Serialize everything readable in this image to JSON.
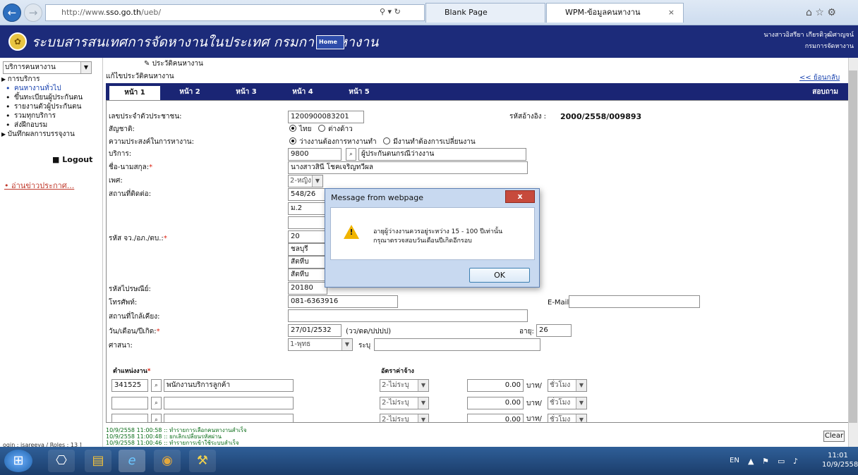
{
  "browser": {
    "url_prefix": "http://www.",
    "url_host": "sso.go.th",
    "url_path": "/ueb/",
    "tabs": [
      "Blank Page",
      "WPM-ข้อมูลคนหางาน"
    ]
  },
  "header": {
    "title": "ระบบสารสนเทศการจัดหางานในประเทศ กรมการจัดหางาน",
    "home_label": "Home",
    "user_name": "นางสาวอิสรียา เกียรติวุฒิศาญจน์",
    "department": "กรมการจัดหางาน"
  },
  "sidebar": {
    "service_select": "บริการคนหางาน",
    "menu_head_1": "การบริการ",
    "items": [
      "คนหางานทั่วไป",
      "ขึ้นทะเบียนผู้ประกันตน",
      "รายงานตัวผู้ประกันตน",
      "รวมทุกบริการ",
      "ส่งฝึกอบรม"
    ],
    "menu_head_2": "บันทึกผลการบรรจุงาน",
    "logout": "Logout",
    "news": "อ่านข่าวประกาศ..."
  },
  "content": {
    "crumb": "ประวัติคนหางาน",
    "page_title": "แก้ไขประวัติคนหางาน",
    "back": "<< ย้อนกลับ",
    "tabs": [
      "หน้า 1",
      "หน้า 2",
      "หน้า 3",
      "หน้า 4",
      "หน้า 5"
    ],
    "tab_right": "สอบถาม"
  },
  "form": {
    "id_label": "เลขประจำตัวประชาชน:",
    "id_value": "1200900083201",
    "ref_label": "รหัสอ้างอิง :",
    "ref_value": "2000/2558/009893",
    "nationality_label": "สัญชาติ:",
    "nationality_opt1": "ไทย",
    "nationality_opt2": "ต่างด้าว",
    "intent_label": "ความประสงค์ในการหางาน:",
    "intent_opt1": "ว่างงานต้องการหางานทำ",
    "intent_opt2": "มีงานทำต้องการเปลี่ยนงาน",
    "service_label": "บริการ:",
    "service_code": "9800",
    "service_name": "ผู้ประกันตนกรณีว่างงาน",
    "name_label": "ชื่อ-นามสกุล:",
    "name_value": "นางสาวสินี โชคเจริญทวีผล",
    "gender_label": "เพศ:",
    "gender_value": "2-หญิง",
    "address_label": "สถานที่ติดต่อ:",
    "address_1": "548/26",
    "address_2": "ม.2",
    "address_3": "",
    "region_label": "รหัส จว./อภ./ตบ.:",
    "province_code": "20",
    "province": "ชลบุรี",
    "amphoe": "สัตหีบ",
    "tambon": "สัตหีบ",
    "postal_label": "รหัสไปรษณีย์:",
    "postal_value": "20180",
    "phone_label": "โทรศัพท์:",
    "phone_value": "081-6363916",
    "email_label": "E-Mail:",
    "email_value": "",
    "nearby_label": "สถานที่ใกล้เคียง:",
    "nearby_value": "",
    "dob_label": "วัน/เดือน/ปีเกิด:",
    "dob_value": "27/01/2532",
    "dob_format": "(วว/ดด/ปปปป)",
    "age_label": "อายุ:",
    "age_value": "26",
    "religion_label": "ศาสนา:",
    "religion_value": "1-พุทธ",
    "religion_other_label": "ระบุ",
    "position_label": "ตำแหน่งงาน",
    "wage_label": "อัตราค่าจ้าง",
    "positions": [
      {
        "code": "341525",
        "name": "พนักงานบริการลูกค้า",
        "wage_type": "2-ไม่ระบุ",
        "amount": "0.00",
        "unit_label": "บาท/",
        "unit": "ชั่วโมง"
      },
      {
        "code": "",
        "name": "",
        "wage_type": "2-ไม่ระบุ",
        "amount": "0.00",
        "unit_label": "บาท/",
        "unit": "ชั่วโมง"
      },
      {
        "code": "",
        "name": "",
        "wage_type": "2-ไม่ระบุ",
        "amount": "0.00",
        "unit_label": "บาท/",
        "unit": "ชั่วโมง"
      }
    ]
  },
  "status": {
    "lines": [
      "10/9/2558 11:00:58 :: ทำรายการเลือกคนหางานสำเร็จ",
      "10/9/2558 11:00:48 :: ยกเลิกเปลี่ยนรหัสผ่าน",
      "10/9/2558 11:00:46 :: ทำรายการเข้าใช้ระบบสำเร็จ"
    ],
    "clear": "Clear",
    "login_info": "ogin : isareeya / Roles : 13 ]"
  },
  "dialog": {
    "title": "Message from webpage",
    "close": "x",
    "message_1": "อายุผู้ว่างงานควรอยู่ระหว่าง 15 - 100 ปีเท่านั้น",
    "message_2": "กรุณาตรวจสอบวันเดือนปีเกิดอีกรอบ",
    "ok": "OK"
  },
  "taskbar": {
    "lang": "EN",
    "time": "11:01",
    "date": "10/9/2558"
  },
  "icons": {
    "warning": "warning-icon",
    "lookup": "lookup-icon",
    "dropdown": "chevron-down-icon"
  }
}
